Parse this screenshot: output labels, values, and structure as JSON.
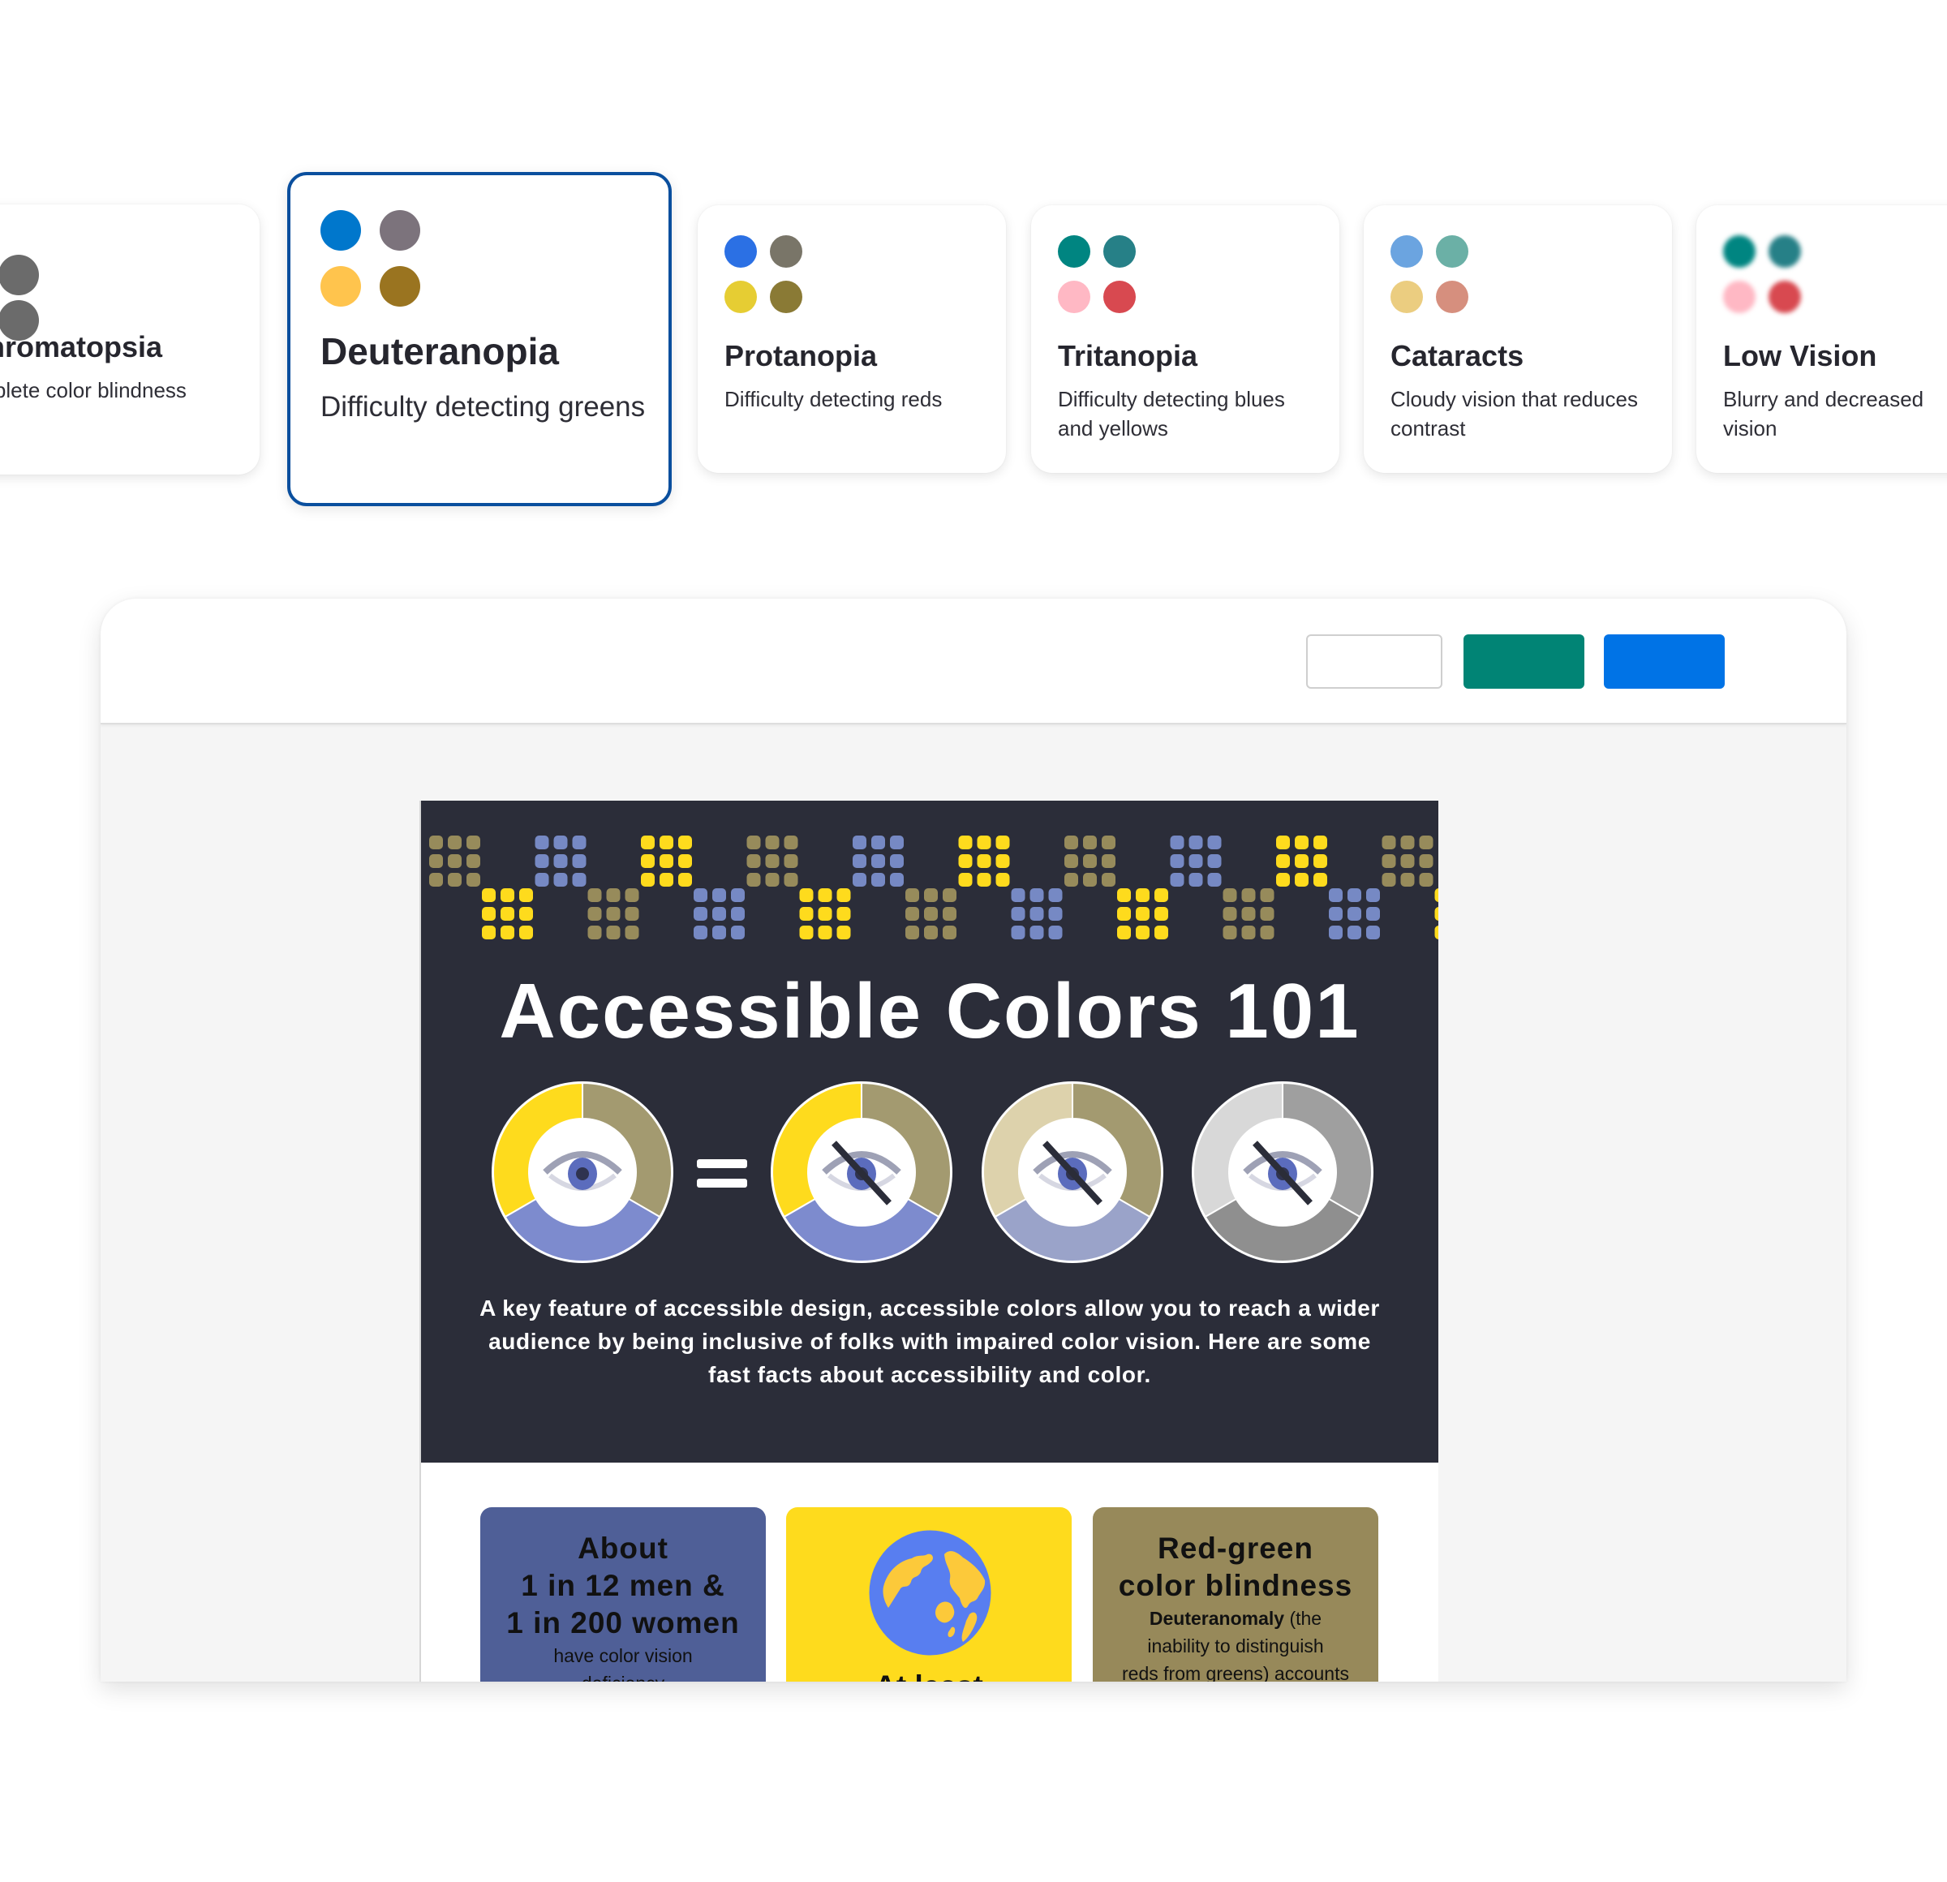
{
  "vision_cards": [
    {
      "title": "Achromatopsia",
      "description": "Complete color blindness",
      "colors": [
        "#6b6b6b",
        "#6b6b6b",
        "#c4c4c4",
        "#6b6b6b"
      ],
      "selected": false,
      "blurred": false
    },
    {
      "title": "Deuteranopia",
      "description": "Difficulty detecting greens",
      "colors": [
        "#0077cc",
        "#7c737c",
        "#ffc44d",
        "#9a7420"
      ],
      "selected": true,
      "blurred": false
    },
    {
      "title": "Protanopia",
      "description": "Difficulty detecting reds",
      "colors": [
        "#2b70e4",
        "#797568",
        "#e6cd33",
        "#8a7a35"
      ],
      "selected": false,
      "blurred": false
    },
    {
      "title": "Tritanopia",
      "description": "Difficulty detecting blues and yellows",
      "colors": [
        "#008581",
        "#268087",
        "#ffb8c4",
        "#d84950"
      ],
      "selected": false,
      "blurred": false
    },
    {
      "title": "Cataracts",
      "description": "Cloudy vision that reduces contrast",
      "colors": [
        "#6ba4e0",
        "#6bb0a6",
        "#ebcd80",
        "#d68f7e"
      ],
      "selected": false,
      "blurred": false
    },
    {
      "title": "Low Vision",
      "description": "Blurry and decreased vision",
      "colors": [
        "#008581",
        "#268087",
        "#ffb8c4",
        "#d84950"
      ],
      "selected": false,
      "blurred": true
    }
  ],
  "toolbar": {
    "buttons": [
      {
        "name": "blank-button",
        "color": "#ffffff"
      },
      {
        "name": "teal-button",
        "color": "#018475"
      },
      {
        "name": "blue-button",
        "color": "#0073e6"
      }
    ]
  },
  "infographic": {
    "title": "Accessible Colors 101",
    "description": "A key feature of accessible design, accessible colors allow you to reach a wider audience by being inclusive of folks with impaired color vision. Here are some fast facts about accessibility and color.",
    "equals_sign": "=",
    "pattern_colors": [
      "#978b5b",
      "#7689c4",
      "#fedb1d"
    ],
    "wheels": [
      {
        "name": "normal-vision",
        "segments": [
          "#fedb1d",
          "#a39a70",
          "#7d8bce"
        ],
        "crossed": false
      },
      {
        "name": "deuteranopia",
        "segments": [
          "#fedb1d",
          "#a39a70",
          "#7d8bce"
        ],
        "crossed": true
      },
      {
        "name": "protanopia",
        "segments": [
          "#ddd2ac",
          "#a39a70",
          "#9aa3c9"
        ],
        "crossed": true
      },
      {
        "name": "achromatopsia",
        "segments": [
          "#d8d8d8",
          "#9f9f9f",
          "#8f8f8f"
        ],
        "crossed": true
      }
    ],
    "facts": [
      {
        "big": [
          "About",
          "1 in 12 men &",
          "1 in 200 women"
        ],
        "small": [
          "have color vision",
          "deficiency"
        ]
      },
      {
        "label": "At least"
      },
      {
        "big": [
          "Red-green",
          "color blindness"
        ],
        "bold_term": "Deuteranomaly",
        "small_after_term": " (the",
        "small": [
          "inability to distinguish",
          "reds from greens) accounts"
        ]
      }
    ]
  }
}
